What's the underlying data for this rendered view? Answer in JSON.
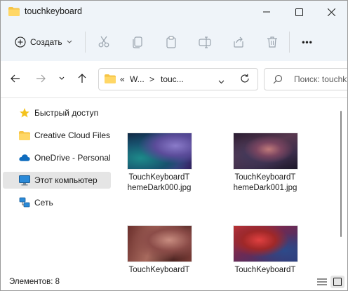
{
  "window": {
    "title": "touchkeyboard"
  },
  "toolbar": {
    "create_label": "Создать",
    "icons": [
      "cut-icon",
      "copy-icon",
      "paste-icon",
      "rename-icon",
      "share-icon",
      "delete-icon"
    ],
    "more_label": "•••"
  },
  "address": {
    "overflow": "«",
    "crumbs": [
      "W...",
      "touc..."
    ],
    "separator": ">"
  },
  "search": {
    "placeholder": "Поиск: touchk"
  },
  "sidebar": {
    "items": [
      {
        "label": "Быстрый доступ",
        "icon": "star-icon"
      },
      {
        "label": "Creative Cloud Files",
        "icon": "creative-cloud-icon"
      },
      {
        "label": "OneDrive - Personal",
        "icon": "onedrive-icon"
      },
      {
        "label": "Этот компьютер",
        "icon": "computer-icon",
        "selected": true
      },
      {
        "label": "Сеть",
        "icon": "network-icon"
      }
    ]
  },
  "files": [
    {
      "line1": "TouchKeyboardT",
      "line2": "hemeDark000.jpg"
    },
    {
      "line1": "TouchKeyboardT",
      "line2": "hemeDark001.jpg"
    },
    {
      "line1": "TouchKeyboardT",
      "line2": ""
    },
    {
      "line1": "TouchKeyboardT",
      "line2": ""
    }
  ],
  "status": {
    "count": "Элементов: 8"
  },
  "colors": {
    "accent": "#0067c0",
    "chrome": "#eff4f9",
    "selected": "#e5e5e5",
    "folder": "#f6c445"
  }
}
